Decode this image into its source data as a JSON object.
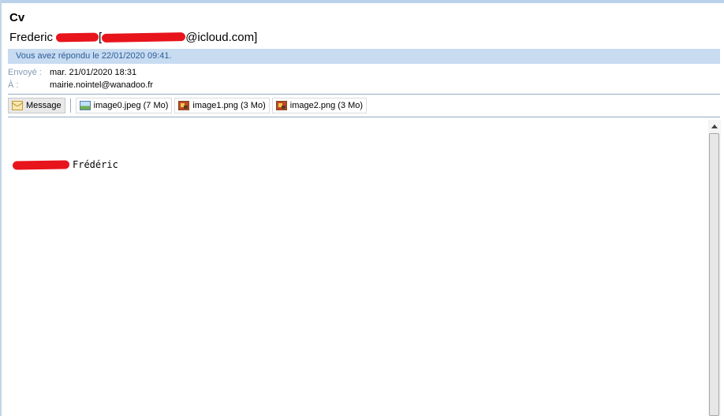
{
  "message": {
    "subject": "Cv",
    "sender_first_name": "Frederic",
    "bracket_open": "[",
    "sender_email_domain": "@icloud.com]",
    "reply_banner": "Vous avez répondu le 22/01/2020 09:41.",
    "sent_label": "Envoyé :",
    "sent_value": "mar. 21/01/2020 18:31",
    "to_label": "À :",
    "to_value": "mairie.nointel@wanadoo.fr"
  },
  "attachments": [
    {
      "label": "Message",
      "icon": "envelope-icon"
    },
    {
      "label": "image0.jpeg (7 Mo)",
      "icon": "image-file-icon"
    },
    {
      "label": "image1.png (3 Mo)",
      "icon": "png-file-icon"
    },
    {
      "label": "image2.png (3 Mo)",
      "icon": "png-file-icon"
    }
  ],
  "body": {
    "signature_first_name": "Frédéric"
  },
  "colors": {
    "banner_bg": "#c7dbf1",
    "banner_text": "#2c5e98",
    "redaction": "#e8141c"
  }
}
